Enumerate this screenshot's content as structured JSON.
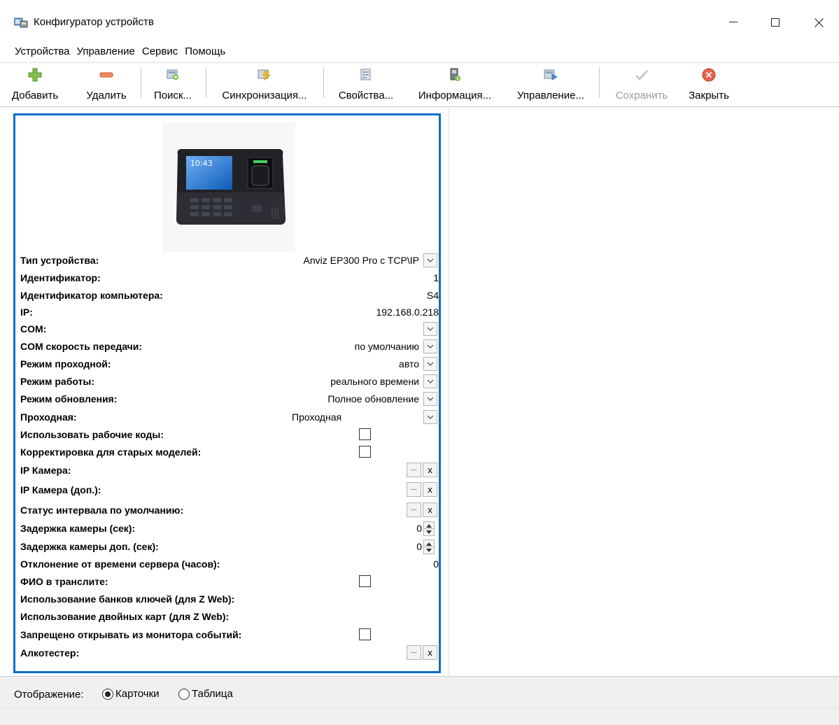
{
  "window": {
    "title": "Конфигуратор устройств"
  },
  "menu": [
    "Устройства",
    "Управление",
    "Сервис",
    "Помощь"
  ],
  "toolbar": {
    "add": "Добавить",
    "remove": "Удалить",
    "search": "Поиск...",
    "sync": "Синхронизация...",
    "properties": "Свойства...",
    "info": "Информация...",
    "manage": "Управление...",
    "save": "Сохранить",
    "close": "Закрыть"
  },
  "colors": {
    "card_border": "#0c6fc7",
    "add_icon": "#7fc04a",
    "remove_icon": "#f08a5d",
    "close_icon": "#e8644a"
  },
  "properties": [
    {
      "label": "Тип устройства:",
      "value": "Anviz EP300 Pro c TCP\\IP"
    },
    {
      "label": "Идентификатор:",
      "value": "1"
    },
    {
      "label": "Идентификатор компьютера:",
      "value": "S4"
    },
    {
      "label": "IP:",
      "value": "192.168.0.218"
    },
    {
      "label": "COM:",
      "value": ""
    },
    {
      "label": "COM скорость передачи:",
      "value": "по умолчанию"
    },
    {
      "label": "Режим проходной:",
      "value": "авто"
    },
    {
      "label": "Режим работы:",
      "value": "реального времени"
    },
    {
      "label": "Режим обновления:",
      "value": "Полное обновление"
    },
    {
      "label": "Проходная:",
      "value": "Проходная"
    },
    {
      "label": "Использовать рабочие коды:",
      "checked": false
    },
    {
      "label": "Корректировка для старых моделей:",
      "checked": false
    },
    {
      "label": "IP Камера:",
      "button_dots": "...",
      "button_x": "x"
    },
    {
      "label": "IP Камера (доп.):",
      "button_dots": "...",
      "button_x": "x"
    },
    {
      "label": "Статус интервала по умолчанию:",
      "button_dots": "...",
      "button_x": "x"
    },
    {
      "label": "Задержка камеры (сек):",
      "value": "0"
    },
    {
      "label": "Задержка камеры доп. (сек):",
      "value": "0"
    },
    {
      "label": "Отклонение от времени сервера (часов):",
      "value": "0"
    },
    {
      "label": "ФИО в транслите:",
      "checked": false
    },
    {
      "label": "Использование банков ключей (для Z Web):"
    },
    {
      "label": "Использование двойных карт (для Z Web):"
    },
    {
      "label": "Запрещено открывать из монитора событий:",
      "checked": false
    },
    {
      "label": "Алкотестер:",
      "button_dots": "...",
      "button_x": "x"
    }
  ],
  "device_screen_time": "10:43",
  "bottom": {
    "display_label": "Отображение:",
    "option_cards": "Карточки",
    "option_table": "Таблица",
    "selected": "Карточки"
  }
}
